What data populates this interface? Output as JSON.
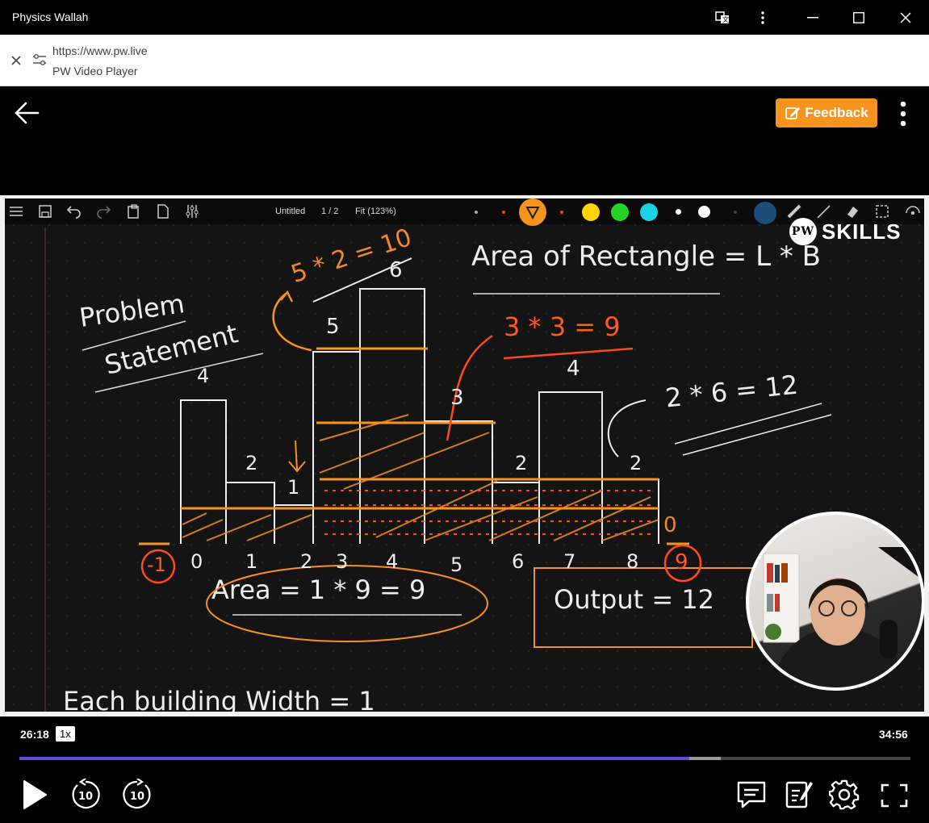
{
  "window": {
    "title": "Physics Wallah"
  },
  "urlbar": {
    "url": "https://www.pw.live",
    "page_name": "PW Video Player"
  },
  "header": {
    "feedback_label": "Feedback",
    "accent": "#f7941d"
  },
  "notebook": {
    "doc_title": "Untitled",
    "page_indicator": "1 / 2",
    "zoom": "Fit (123%)",
    "brand": "SKILLS",
    "brand_badge": "PW",
    "colors": [
      "#f7941d",
      "#ffd400",
      "#2bd12b",
      "#1ad1e6",
      "#ffffff"
    ]
  },
  "board": {
    "title_area_rect": "Area of Rectangle = L * B",
    "problem": "Problem",
    "statement": "Statement",
    "calc_top": "5 * 2 = 10",
    "calc_mid": "3 * 3 = 9",
    "calc_right": "2 * 6 = 12",
    "area_eq": "Area = 1 * 9 = 9",
    "output": "Output = 12",
    "width_note": "Each building Width = 1",
    "heights": [
      "4",
      "2",
      "1",
      "5",
      "6",
      "3",
      "2",
      "4",
      "2",
      "0"
    ],
    "indices": [
      "-1",
      "0",
      "1",
      "2",
      "3",
      "4",
      "5",
      "6",
      "7",
      "8",
      "9"
    ],
    "bar_three_label": "3"
  },
  "player": {
    "current_time": "26:18",
    "speed": "1x",
    "total_time": "34:56",
    "progress": 0.752,
    "buffered": 0.787,
    "rewind_label": "10",
    "forward_label": "10",
    "progress_color": "#5b4ee0"
  }
}
